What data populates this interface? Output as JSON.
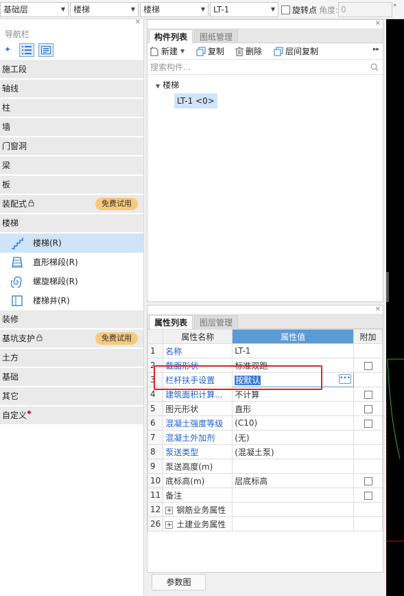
{
  "toolbar": {
    "floor": "基础层",
    "category": "楼梯",
    "type": "楼梯",
    "component": "LT-1",
    "rotate_label": "旋转点",
    "angle_label": "角度:",
    "angle_value": "0",
    "degree_unit": "°"
  },
  "nav": {
    "title": "导航栏",
    "categories": [
      {
        "label": "施工段"
      },
      {
        "label": "轴线"
      },
      {
        "label": "柱"
      },
      {
        "label": "墙"
      },
      {
        "label": "门窗洞"
      },
      {
        "label": "梁"
      },
      {
        "label": "板"
      },
      {
        "label": "装配式",
        "badge": "免费试用"
      },
      {
        "label": "楼梯"
      },
      {
        "label": "装修"
      },
      {
        "label": "基坑支护",
        "badge": "免费试用"
      },
      {
        "label": "土方"
      },
      {
        "label": "基础"
      },
      {
        "label": "其它"
      },
      {
        "label": "自定义"
      }
    ],
    "stair_items": [
      {
        "label": "楼梯(R)",
        "icon": "stair-icon",
        "selected": true
      },
      {
        "label": "直形梯段(R)",
        "icon": "straight-flight-icon"
      },
      {
        "label": "螺旋梯段(R)",
        "icon": "spiral-flight-icon"
      },
      {
        "label": "楼梯井(R)",
        "icon": "stairwell-icon"
      }
    ]
  },
  "component_panel": {
    "tabs": [
      "构件列表",
      "图纸管理"
    ],
    "buttons": {
      "new": "新建",
      "copy": "复制",
      "delete": "删除",
      "floor_copy": "层间复制"
    },
    "search_placeholder": "搜索构件...",
    "tree_root": "楼梯",
    "tree_leaf": "LT-1 <0>"
  },
  "property_panel": {
    "tabs": [
      "属性列表",
      "图层管理"
    ],
    "headers": {
      "name": "属性名称",
      "value": "属性值",
      "extra": "附加"
    },
    "rows": [
      {
        "num": "1",
        "name": "名称",
        "value": "LT-1",
        "blue": true,
        "check": false
      },
      {
        "num": "2",
        "name": "截面形状",
        "value": "标准双跑",
        "blue": true,
        "check": true
      },
      {
        "num": "3",
        "name": "栏杆扶手设置",
        "value": "按默认",
        "blue": true,
        "check": false,
        "editing": true
      },
      {
        "num": "4",
        "name": "建筑面积计算...",
        "value": "不计算",
        "blue": true,
        "check": true
      },
      {
        "num": "5",
        "name": "图元形状",
        "value": "直形",
        "blue": false,
        "check": true
      },
      {
        "num": "6",
        "name": "混凝土强度等级",
        "value": "(C10)",
        "blue": true,
        "check": true
      },
      {
        "num": "7",
        "name": "混凝土外加剂",
        "value": "(无)",
        "blue": true,
        "check": false
      },
      {
        "num": "8",
        "name": "泵送类型",
        "value": "(混凝土泵)",
        "blue": true,
        "check": false
      },
      {
        "num": "9",
        "name": "泵送高度(m)",
        "value": "",
        "blue": false,
        "check": false
      },
      {
        "num": "10",
        "name": "底标高(m)",
        "value": "层底标高",
        "blue": false,
        "check": true
      },
      {
        "num": "11",
        "name": "备注",
        "value": "",
        "blue": false,
        "check": true
      },
      {
        "num": "12",
        "name": "钢筋业务属性",
        "value": "",
        "blue": false,
        "check": false,
        "group": true
      },
      {
        "num": "26",
        "name": "土建业务属性",
        "value": "",
        "blue": false,
        "check": false,
        "group": true
      }
    ],
    "param_button": "参数图"
  },
  "colors": {
    "accent": "#5b9bd5",
    "selection": "#cfe4f8",
    "highlight": "#e02020",
    "badge": "#f7c97a",
    "link": "#2261c4"
  }
}
